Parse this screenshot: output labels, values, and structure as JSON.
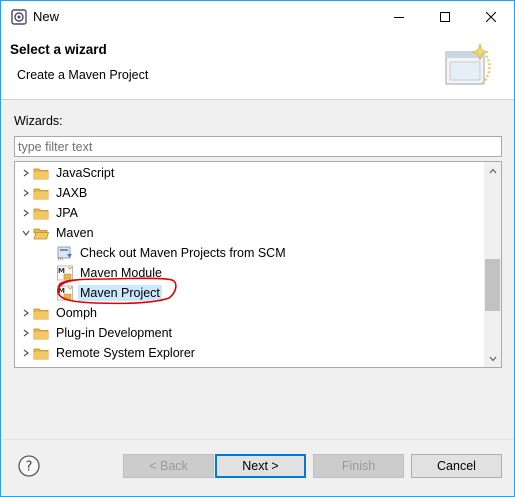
{
  "window": {
    "title": "New",
    "controls": [
      "minimize",
      "maximize",
      "close"
    ]
  },
  "banner": {
    "title": "Select a wizard",
    "description": "Create a Maven Project",
    "icon": "new-wizard-graphic"
  },
  "filter": {
    "label": "Wizards:",
    "placeholder": "type filter text",
    "value": ""
  },
  "tree": {
    "items": [
      {
        "label": "JavaScript",
        "level": 0,
        "expanded": false,
        "icon": "folder-icon"
      },
      {
        "label": "JAXB",
        "level": 0,
        "expanded": false,
        "icon": "folder-icon"
      },
      {
        "label": "JPA",
        "level": 0,
        "expanded": false,
        "icon": "folder-icon"
      },
      {
        "label": "Maven",
        "level": 0,
        "expanded": true,
        "icon": "folder-icon"
      },
      {
        "label": "Check out Maven Projects from SCM",
        "level": 1,
        "icon": "maven-checkout-icon"
      },
      {
        "label": "Maven Module",
        "level": 1,
        "icon": "maven-module-icon"
      },
      {
        "label": "Maven Project",
        "level": 1,
        "icon": "maven-project-icon",
        "selected": true
      },
      {
        "label": "Oomph",
        "level": 0,
        "expanded": false,
        "icon": "folder-icon"
      },
      {
        "label": "Plug-in Development",
        "level": 0,
        "expanded": false,
        "icon": "folder-icon"
      },
      {
        "label": "Remote System Explorer",
        "level": 0,
        "expanded": false,
        "icon": "folder-icon"
      }
    ]
  },
  "buttons": {
    "back": "< Back",
    "next": "Next >",
    "finish": "Finish",
    "cancel": "Cancel"
  },
  "colors": {
    "selection": "#cce8ff",
    "annotation": "#e00000",
    "folder": "#e8b64a",
    "focus": "#0078d7"
  }
}
